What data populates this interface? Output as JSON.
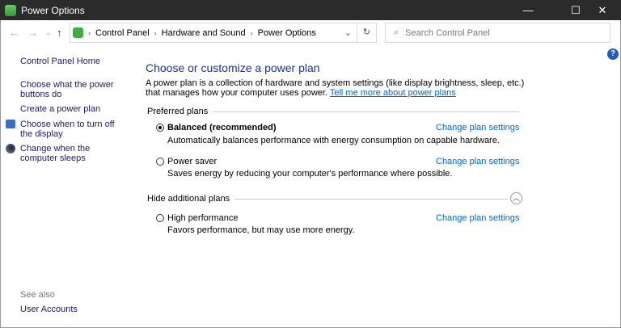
{
  "window": {
    "title": "Power Options",
    "minimize": "—",
    "maximize": "☐",
    "close": "✕"
  },
  "address": {
    "crumbs": [
      "Control Panel",
      "Hardware and Sound",
      "Power Options"
    ],
    "search_placeholder": "Search Control Panel"
  },
  "sidebar": {
    "items": [
      "Control Panel Home",
      "Choose what the power buttons do",
      "Create a power plan",
      "Choose when to turn off the display",
      "Change when the computer sleeps"
    ],
    "see_also": "See also",
    "user_accounts": "User Accounts"
  },
  "main": {
    "title": "Choose or customize a power plan",
    "desc": "A power plan is a collection of hardware and system settings (like display brightness, sleep, etc.) that manages how your computer uses power. ",
    "desc_link": "Tell me more about power plans",
    "preferred": "Preferred plans",
    "hide": "Hide additional plans",
    "change": "Change plan settings",
    "plans": [
      {
        "name": "Balanced (recommended)",
        "desc": "Automatically balances performance with energy consumption on capable hardware.",
        "selected": true
      },
      {
        "name": "Power saver",
        "desc": "Saves energy by reducing your computer's performance where possible.",
        "selected": false
      },
      {
        "name": "High performance",
        "desc": "Favors performance, but may use more energy.",
        "selected": false
      }
    ]
  }
}
